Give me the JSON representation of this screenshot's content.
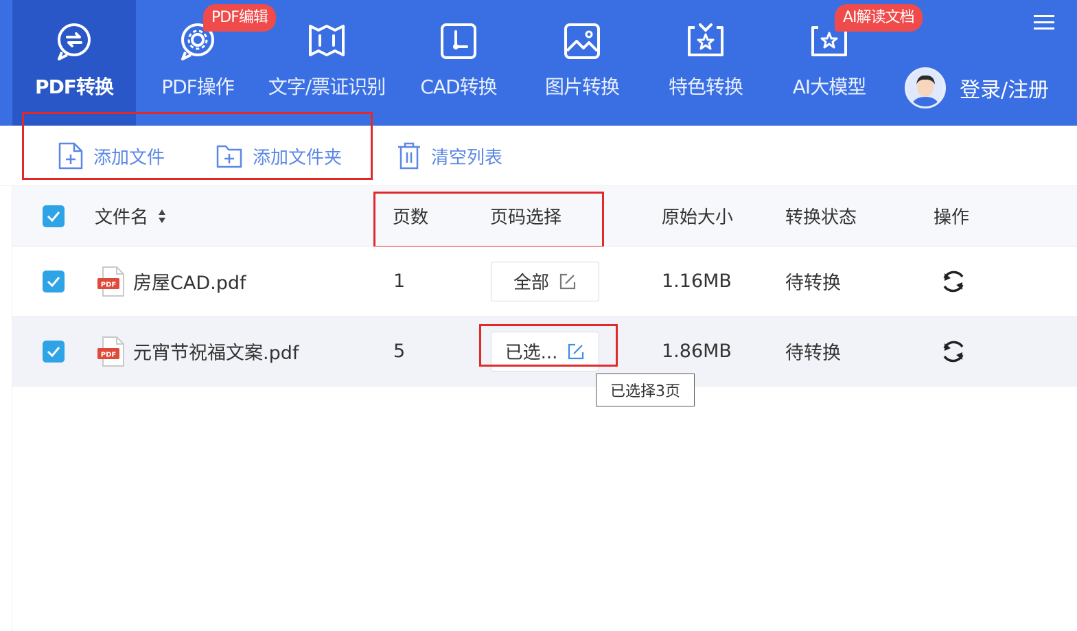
{
  "nav": {
    "items": [
      {
        "label": "PDF转换",
        "icon": "convert-circle-icon"
      },
      {
        "label": "PDF操作",
        "icon": "gear-circle-icon"
      },
      {
        "label": "文字/票证识别",
        "icon": "scan-frame-icon"
      },
      {
        "label": "CAD转换",
        "icon": "cad-icon"
      },
      {
        "label": "图片转换",
        "icon": "image-icon"
      },
      {
        "label": "特色转换",
        "icon": "star-box-icon"
      },
      {
        "label": "AI大模型",
        "icon": "ai-star-icon"
      }
    ],
    "badge_pdf_edit": "PDF编辑",
    "badge_ai_read": "AI解读文档",
    "login_label": "登录/注册"
  },
  "toolbar": {
    "add_file": "添加文件",
    "add_folder": "添加文件夹",
    "clear_list": "清空列表"
  },
  "table": {
    "headers": {
      "filename": "文件名",
      "pages": "页数",
      "page_select": "页码选择",
      "size": "原始大小",
      "status": "转换状态",
      "action": "操作"
    },
    "rows": [
      {
        "name": "房屋CAD.pdf",
        "pages": "1",
        "page_select": "全部",
        "size": "1.16MB",
        "status": "待转换"
      },
      {
        "name": "元宵节祝福文案.pdf",
        "pages": "5",
        "page_select": "已选...",
        "size": "1.86MB",
        "status": "待转换"
      }
    ]
  },
  "tooltip": "已选择3页",
  "colors": {
    "nav_bg": "#3a6fe3",
    "nav_active": "#2a57c7",
    "badge": "#ef4b4b",
    "accent": "#5a86e6",
    "checkbox": "#2ea4e6",
    "highlight_box": "#e02a2a"
  }
}
